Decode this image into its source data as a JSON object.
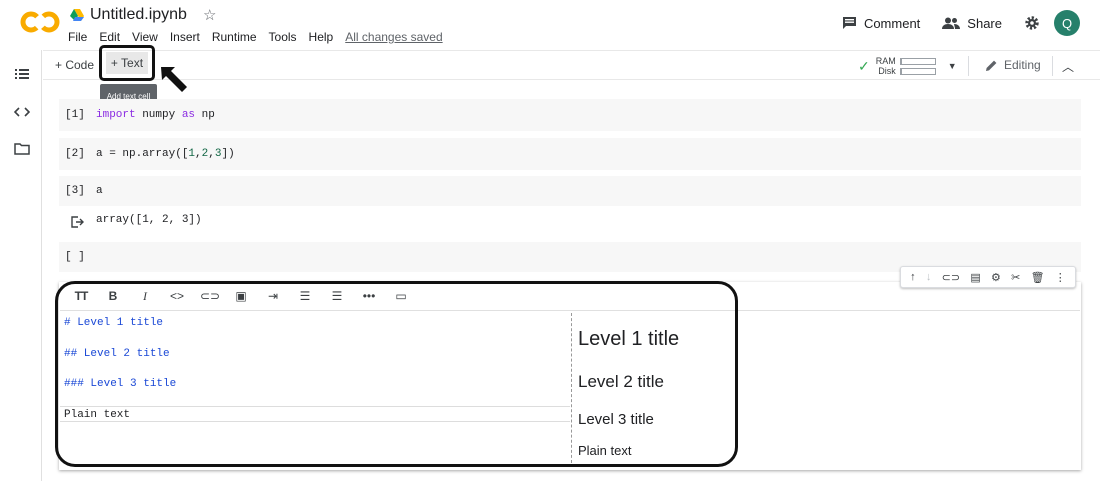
{
  "header": {
    "logo_text": "CO",
    "title": "Untitled.ipynb",
    "menu": [
      "File",
      "Edit",
      "View",
      "Insert",
      "Runtime",
      "Tools",
      "Help"
    ],
    "saved_status": "All changes saved",
    "comment_label": "Comment",
    "share_label": "Share",
    "avatar_initial": "Q"
  },
  "toolbar": {
    "add_code_label": "+ Code",
    "add_text_label": "+ Text",
    "tooltip": "Add text cell",
    "ram_label": "RAM",
    "disk_label": "Disk",
    "ram_usage": 0.05,
    "disk_usage": 0.05,
    "editing_label": "Editing"
  },
  "cells": [
    {
      "num": "[1]"
    },
    {
      "num": "[2]"
    },
    {
      "num": "[3]",
      "output": "array([1, 2, 3])"
    },
    {
      "num": "[ ]"
    }
  ],
  "code": {
    "c1_import": "import",
    "c1_mod": " numpy ",
    "c1_as": "as",
    "c1_alias": " np",
    "c2_pre": "a = np.array([",
    "c2_n1": "1",
    "c2_c1": ",",
    "c2_n2": "2",
    "c2_c2": ",",
    "c2_n3": "3",
    "c2_post": "])",
    "c3_src": "a"
  },
  "text_cell": {
    "source": [
      "# Level 1 title",
      "## Level 2 title",
      "### Level 3 title",
      "Plain text"
    ],
    "preview": [
      "Level 1 title",
      "Level 2 title",
      "Level 3 title",
      "Plain text"
    ]
  },
  "colors": {
    "accent_logo": "#f9ab00",
    "avatar_bg": "#26806b",
    "markdown_blue": "#1a48d6",
    "keyword_purple": "#8a2be2",
    "number_green": "#116644"
  }
}
